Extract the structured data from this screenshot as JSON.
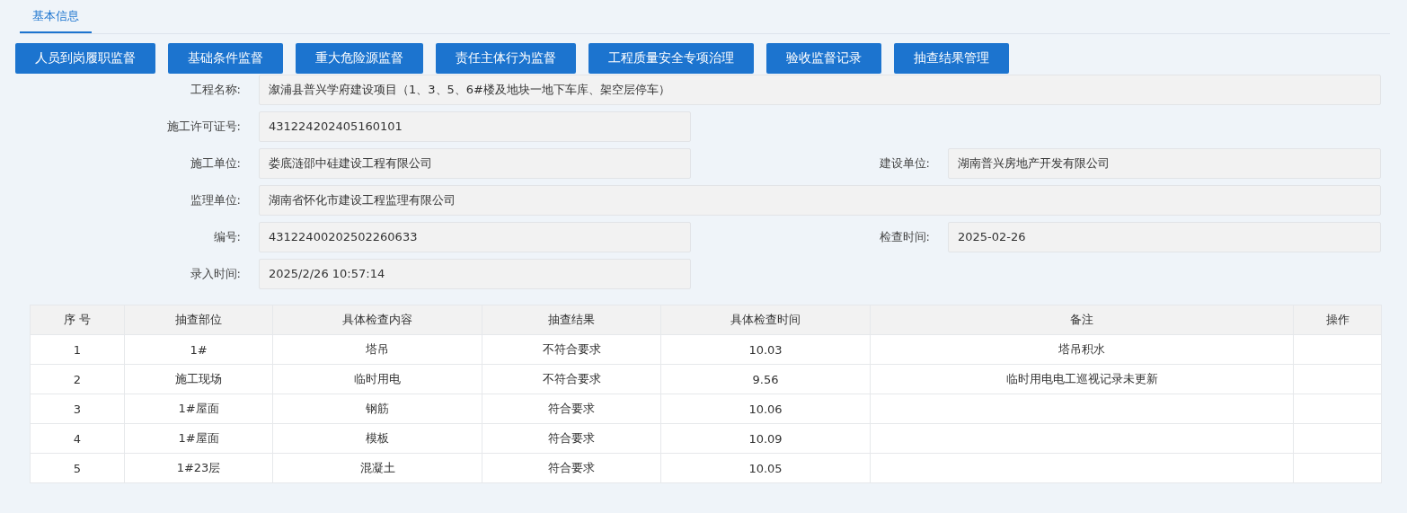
{
  "tabs": [
    {
      "label": "基本信息",
      "selected": true
    }
  ],
  "buttons": [
    "人员到岗履职监督",
    "基础条件监督",
    "重大危险源监督",
    "责任主体行为监督",
    "工程质量安全专项治理",
    "验收监督记录",
    "抽查结果管理"
  ],
  "form_rows": [
    {
      "kind": "wide",
      "fields": [
        {
          "label": "工程名称:",
          "value": "溆浦县普兴学府建设项目（1、3、5、6#楼及地块一地下车库、架空层停车）"
        }
      ]
    },
    {
      "kind": "pair",
      "fields": [
        {
          "label": "施工许可证号:",
          "value": "431224202405160101"
        }
      ]
    },
    {
      "kind": "pair",
      "fields": [
        {
          "label": "施工单位:",
          "value": "娄底涟邵中硅建设工程有限公司"
        },
        {
          "label": "建设单位:",
          "value": "湖南普兴房地产开发有限公司"
        }
      ]
    },
    {
      "kind": "wide",
      "fields": [
        {
          "label": "监理单位:",
          "value": "湖南省怀化市建设工程监理有限公司"
        }
      ]
    },
    {
      "kind": "pair",
      "fields": [
        {
          "label": "编号:",
          "value": "43122400202502260633"
        },
        {
          "label": "检查时间:",
          "value": "2025-02-26"
        }
      ]
    },
    {
      "kind": "pair",
      "fields": [
        {
          "label": "录入时间:",
          "value": "2025/2/26 10:57:14"
        }
      ]
    }
  ],
  "table": {
    "columns": [
      "序 号",
      "抽查部位",
      "具体检查内容",
      "抽查结果",
      "具体检查时间",
      "备注",
      "操作"
    ],
    "rows": [
      {
        "cells": [
          "1",
          "1#",
          "塔吊",
          "不符合要求",
          "10.03",
          "塔吊积水"
        ]
      },
      {
        "cells": [
          "2",
          "施工现场",
          "临时用电",
          "不符合要求",
          "9.56",
          "临时用电电工巡视记录未更新"
        ]
      },
      {
        "cells": [
          "3",
          "1#屋面",
          "钢筋",
          "符合要求",
          "10.06"
        ]
      },
      {
        "cells": [
          "4",
          "1#屋面",
          "模板",
          "符合要求",
          "10.09"
        ]
      },
      {
        "cells": [
          "5",
          "1#23层",
          "混凝土",
          "符合要求",
          "10.05"
        ]
      }
    ]
  }
}
